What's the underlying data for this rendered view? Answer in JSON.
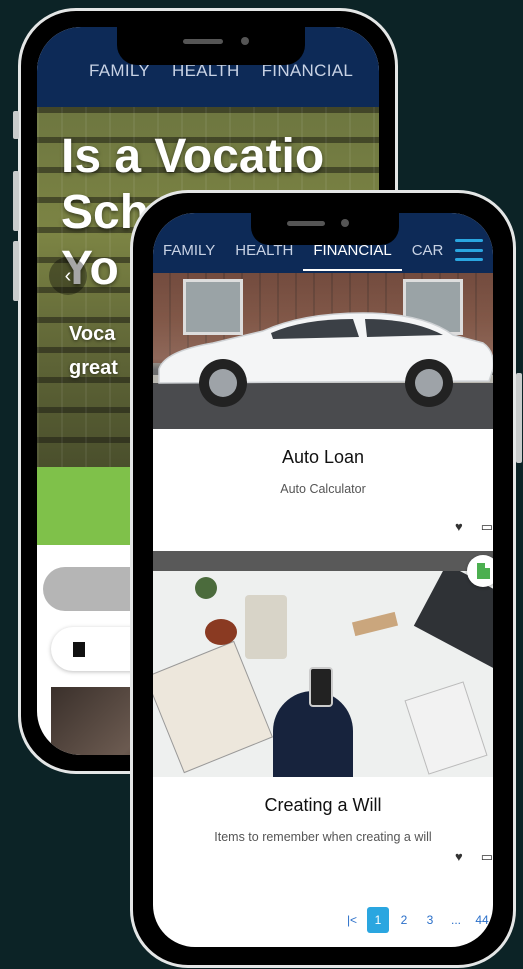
{
  "back_phone": {
    "nav_tabs": [
      "FAMILY",
      "HEALTH",
      "FINANCIAL"
    ],
    "hero_title_lines": [
      "Is a Vocatio",
      "Sch",
      "Yo"
    ],
    "hero_subtitle_lines": [
      "Voca",
      "great"
    ],
    "prev_icon": "chevron-left-icon"
  },
  "front_phone": {
    "nav_tabs": [
      "FAMILY",
      "HEALTH",
      "FINANCIAL",
      "CAR"
    ],
    "active_tab": "FINANCIAL",
    "cards": [
      {
        "title": "Auto Loan",
        "subtitle": "Auto Calculator",
        "image": "white-car-photo"
      },
      {
        "title": "Creating a Will",
        "subtitle": "Items to remember when creating a will",
        "image": "desk-documents-photo"
      }
    ],
    "pagination": {
      "first": "|<",
      "pages": [
        "1",
        "2",
        "3"
      ],
      "ellipsis": "...",
      "last_page": "44",
      "current": "1"
    }
  },
  "colors": {
    "background": "#0c2326",
    "nav": "#0d2a57",
    "accent": "#2aa6e0",
    "green": "#7fc14a"
  }
}
